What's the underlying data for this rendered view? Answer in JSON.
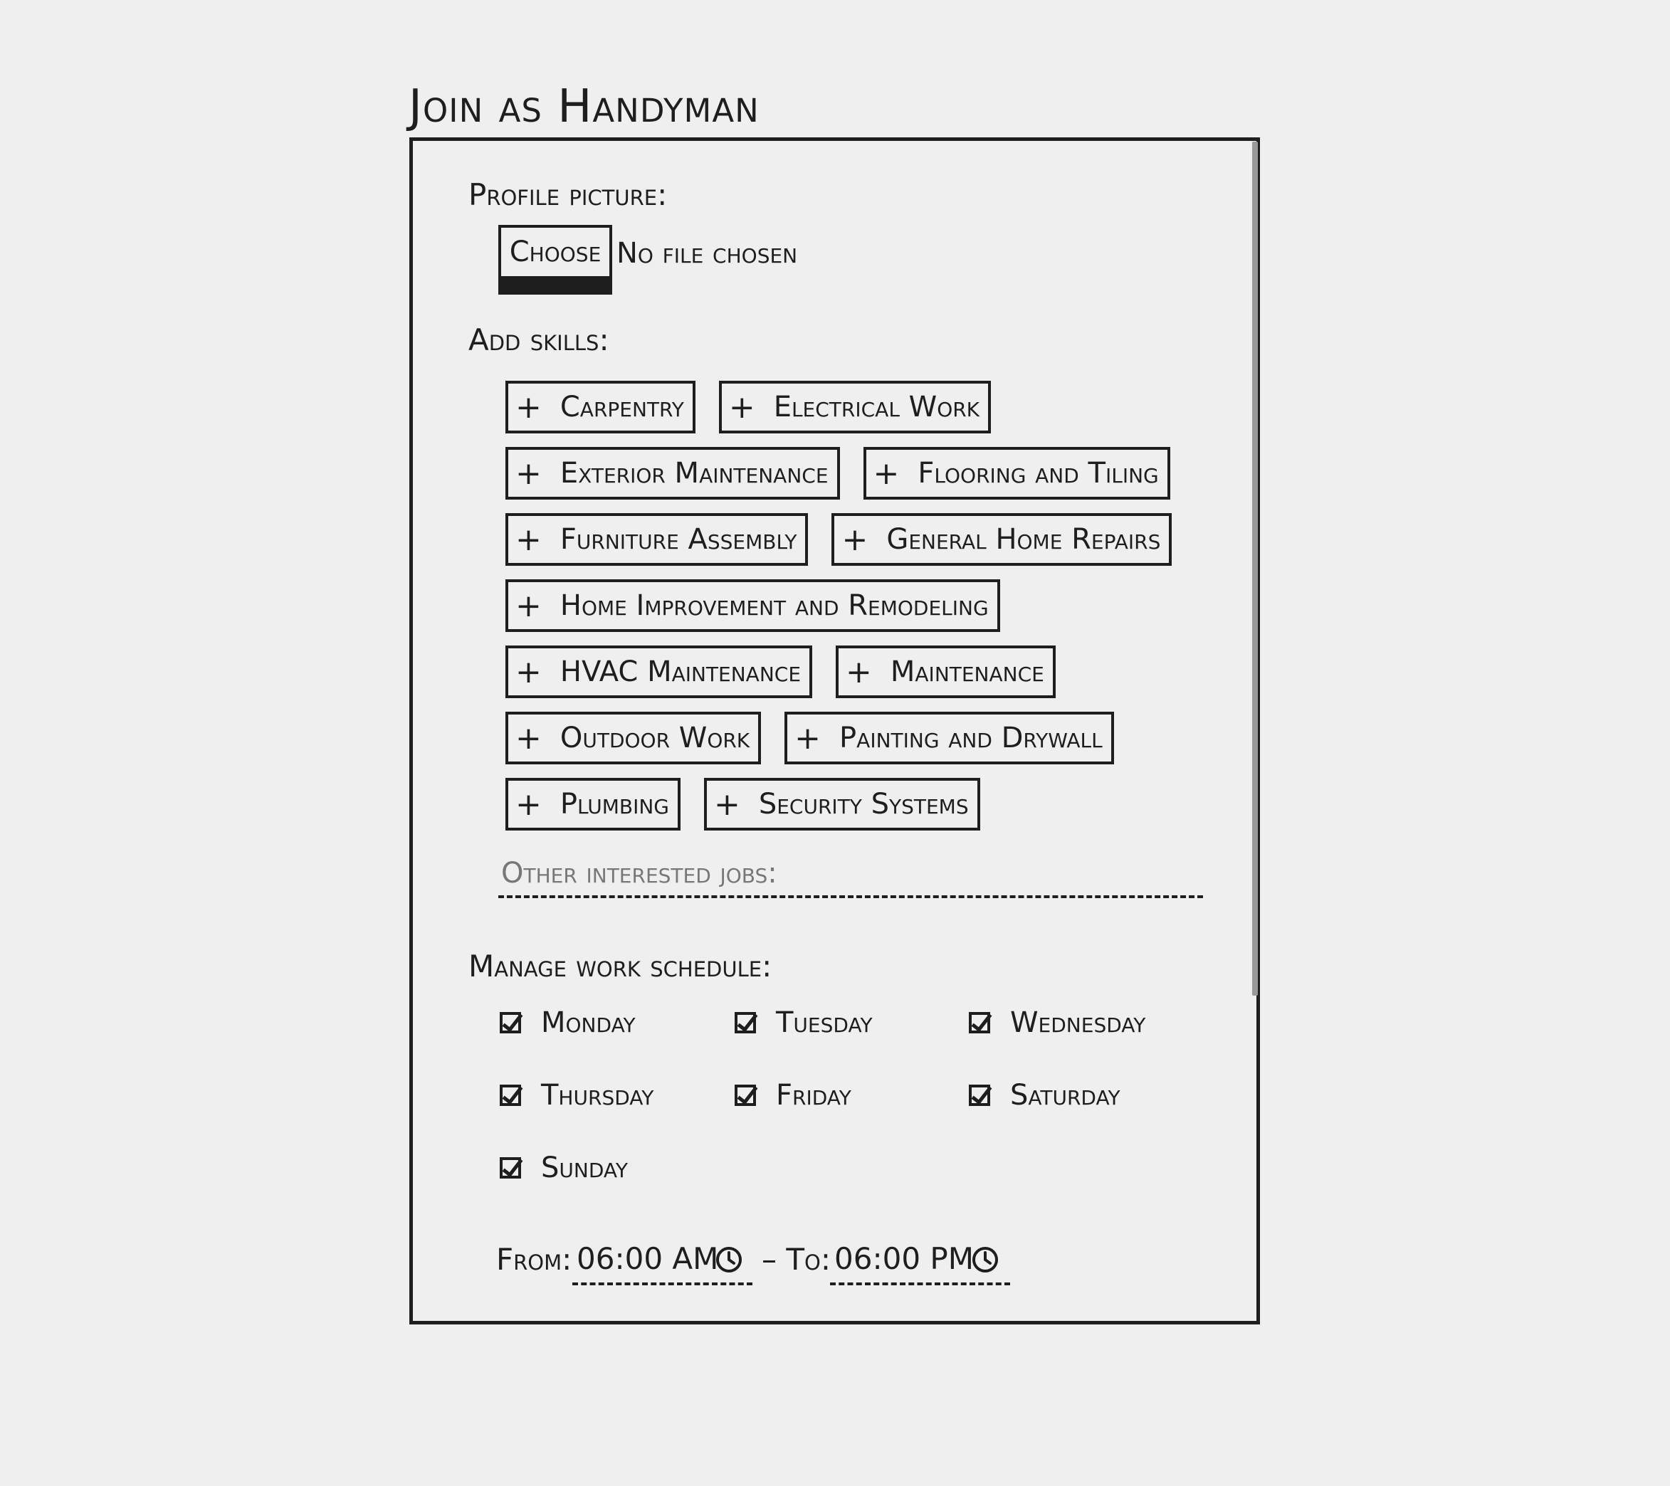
{
  "title": "Join as Handyman",
  "profile": {
    "label": "Profile picture:",
    "choose_label": "Choose",
    "file_status": "No file chosen"
  },
  "skills": {
    "label": "Add skills:",
    "plus_glyph": "+",
    "items": [
      "Carpentry",
      "Electrical Work",
      "Exterior Maintenance",
      "Flooring and Tiling",
      "Furniture Assembly",
      "General Home Repairs",
      "Home Improvement and Remodeling",
      "HVAC Maintenance",
      "Maintenance",
      "Outdoor Work",
      "Painting and Drywall",
      "Plumbing",
      "Security Systems"
    ]
  },
  "other_jobs": {
    "placeholder": "Other interested jobs:",
    "value": ""
  },
  "schedule": {
    "label": "Manage work schedule:",
    "days": [
      {
        "label": "Monday",
        "checked": true
      },
      {
        "label": "Tuesday",
        "checked": true
      },
      {
        "label": "Wednesday",
        "checked": true
      },
      {
        "label": "Thursday",
        "checked": true
      },
      {
        "label": "Friday",
        "checked": true
      },
      {
        "label": "Saturday",
        "checked": true
      },
      {
        "label": "Sunday",
        "checked": true
      }
    ],
    "from_label": "From:",
    "from_value": "06:00 AM",
    "separator": "– To:",
    "to_value": "06:00 PM"
  },
  "colors": {
    "background": "#efefef",
    "ink": "#1e1e1e",
    "placeholder": "#777777"
  }
}
